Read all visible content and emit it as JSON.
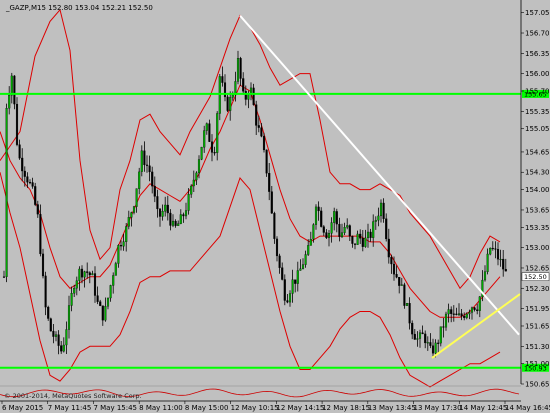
{
  "chart_data": {
    "type": "candlestick",
    "title": "_GAZP,M15  152.80 153.04 152.21 152.50",
    "symbol": "_GAZP,M15",
    "ohlc_header": [
      "152.80",
      "153.04",
      "152.21",
      "152.50"
    ],
    "copyright": "© 2001-2014, MetaQuotes Software Corp.",
    "ylim": [
      150.65,
      157.2
    ],
    "y_ticks": [
      "157.05",
      "156.70",
      "156.35",
      "156.00",
      "155.70",
      "155.35",
      "155.05",
      "154.65",
      "154.30",
      "154.00",
      "153.65",
      "153.35",
      "153.00",
      "152.65",
      "152.30",
      "151.95",
      "151.65",
      "151.30",
      "151.00",
      "150.65"
    ],
    "x_ticks": [
      "6 May 2015",
      "7 May 11:45",
      "7 May 15:45",
      "8 May 11:00",
      "8 May 15:00",
      "12 May 10:15",
      "12 May 14:15",
      "12 May 18:15",
      "13 May 13:45",
      "13 May 17:30",
      "14 May 12:45",
      "14 May 16:45"
    ],
    "horizontal_lines": [
      {
        "price": 155.65,
        "label": "155.65",
        "color": "#00ff00"
      },
      {
        "price": 150.93,
        "label": "150.93",
        "color": "#00ff00"
      }
    ],
    "current_price": {
      "price": 152.5,
      "label": "152.50"
    },
    "trendlines": [
      {
        "color": "#ffffff",
        "from": [
          240,
          157.0
        ],
        "to": [
          519,
          151.5
        ]
      },
      {
        "color": "#ffff55",
        "from": [
          432,
          151.1
        ],
        "to": [
          520,
          152.2
        ]
      }
    ],
    "bollinger_color": "#dd0000",
    "series": {
      "price_path": [
        [
          5,
          155.3
        ],
        [
          12,
          156.0
        ],
        [
          18,
          154.6
        ],
        [
          25,
          154.3
        ],
        [
          32,
          154.0
        ],
        [
          38,
          153.5
        ],
        [
          45,
          152.0
        ],
        [
          50,
          151.6
        ],
        [
          56,
          151.4
        ],
        [
          62,
          151.2
        ],
        [
          68,
          151.8
        ],
        [
          74,
          152.4
        ],
        [
          80,
          152.6
        ],
        [
          86,
          152.6
        ],
        [
          92,
          152.5
        ],
        [
          98,
          152.0
        ],
        [
          104,
          151.8
        ],
        [
          110,
          152.3
        ],
        [
          118,
          153.0
        ],
        [
          126,
          153.3
        ],
        [
          134,
          153.8
        ],
        [
          142,
          154.6
        ],
        [
          150,
          154.3
        ],
        [
          158,
          153.5
        ],
        [
          166,
          153.7
        ],
        [
          174,
          153.3
        ],
        [
          182,
          153.5
        ],
        [
          190,
          153.9
        ],
        [
          198,
          154.5
        ],
        [
          206,
          155.1
        ],
        [
          214,
          154.6
        ],
        [
          220,
          156.0
        ],
        [
          226,
          155.4
        ],
        [
          232,
          155.6
        ],
        [
          238,
          156.2
        ],
        [
          244,
          155.5
        ],
        [
          250,
          155.8
        ],
        [
          256,
          155.2
        ],
        [
          262,
          154.8
        ],
        [
          268,
          154.2
        ],
        [
          274,
          153.2
        ],
        [
          280,
          152.6
        ],
        [
          286,
          152.1
        ],
        [
          292,
          152.4
        ],
        [
          298,
          152.5
        ],
        [
          304,
          152.8
        ],
        [
          310,
          153.0
        ],
        [
          316,
          153.8
        ],
        [
          322,
          153.4
        ],
        [
          328,
          153.2
        ],
        [
          334,
          153.6
        ],
        [
          340,
          153.2
        ],
        [
          346,
          153.4
        ],
        [
          352,
          153.0
        ],
        [
          358,
          153.2
        ],
        [
          364,
          153.1
        ],
        [
          370,
          153.2
        ],
        [
          376,
          153.5
        ],
        [
          382,
          153.8
        ],
        [
          388,
          153.0
        ],
        [
          394,
          152.6
        ],
        [
          400,
          152.4
        ],
        [
          406,
          152.0
        ],
        [
          412,
          151.6
        ],
        [
          418,
          151.4
        ],
        [
          424,
          151.5
        ],
        [
          430,
          151.2
        ],
        [
          436,
          151.3
        ],
        [
          442,
          151.6
        ],
        [
          448,
          151.9
        ],
        [
          454,
          151.8
        ],
        [
          460,
          151.8
        ],
        [
          466,
          151.9
        ],
        [
          472,
          152.0
        ],
        [
          478,
          152.0
        ],
        [
          484,
          152.5
        ],
        [
          490,
          153.0
        ],
        [
          496,
          152.9
        ],
        [
          502,
          152.7
        ],
        [
          507,
          152.5
        ]
      ],
      "bb_upper": [
        [
          0,
          154.5
        ],
        [
          20,
          155.0
        ],
        [
          35,
          156.3
        ],
        [
          50,
          156.9
        ],
        [
          60,
          157.1
        ],
        [
          70,
          156.4
        ],
        [
          80,
          154.5
        ],
        [
          90,
          153.3
        ],
        [
          100,
          152.8
        ],
        [
          110,
          153.0
        ],
        [
          120,
          154.0
        ],
        [
          130,
          154.5
        ],
        [
          140,
          155.2
        ],
        [
          150,
          155.3
        ],
        [
          160,
          155.0
        ],
        [
          170,
          154.8
        ],
        [
          180,
          154.6
        ],
        [
          190,
          155.0
        ],
        [
          200,
          155.3
        ],
        [
          210,
          155.6
        ],
        [
          220,
          156.1
        ],
        [
          230,
          156.6
        ],
        [
          240,
          157.0
        ],
        [
          250,
          156.8
        ],
        [
          260,
          156.5
        ],
        [
          270,
          156.1
        ],
        [
          280,
          155.8
        ],
        [
          290,
          155.9
        ],
        [
          300,
          156.0
        ],
        [
          310,
          156.0
        ],
        [
          320,
          155.2
        ],
        [
          330,
          154.3
        ],
        [
          340,
          154.1
        ],
        [
          350,
          154.1
        ],
        [
          360,
          154.0
        ],
        [
          370,
          154.0
        ],
        [
          380,
          154.1
        ],
        [
          390,
          154.0
        ],
        [
          400,
          153.9
        ],
        [
          410,
          153.6
        ],
        [
          420,
          153.4
        ],
        [
          430,
          153.2
        ],
        [
          440,
          152.9
        ],
        [
          450,
          152.6
        ],
        [
          460,
          152.3
        ],
        [
          470,
          152.5
        ],
        [
          480,
          152.9
        ],
        [
          490,
          153.2
        ],
        [
          500,
          153.1
        ]
      ],
      "bb_middle": [
        [
          0,
          155.0
        ],
        [
          10,
          154.5
        ],
        [
          20,
          154.2
        ],
        [
          30,
          154.0
        ],
        [
          40,
          153.6
        ],
        [
          50,
          153.0
        ],
        [
          60,
          152.5
        ],
        [
          70,
          152.3
        ],
        [
          80,
          152.4
        ],
        [
          90,
          152.5
        ],
        [
          100,
          152.5
        ],
        [
          110,
          152.7
        ],
        [
          120,
          153.1
        ],
        [
          130,
          153.5
        ],
        [
          140,
          153.9
        ],
        [
          150,
          154.1
        ],
        [
          160,
          154.0
        ],
        [
          170,
          153.9
        ],
        [
          180,
          153.8
        ],
        [
          190,
          154.0
        ],
        [
          200,
          154.3
        ],
        [
          210,
          154.7
        ],
        [
          220,
          155.0
        ],
        [
          230,
          155.4
        ],
        [
          240,
          155.8
        ],
        [
          250,
          155.7
        ],
        [
          260,
          155.2
        ],
        [
          270,
          154.6
        ],
        [
          280,
          154.0
        ],
        [
          290,
          153.5
        ],
        [
          300,
          153.2
        ],
        [
          310,
          153.1
        ],
        [
          320,
          153.2
        ],
        [
          330,
          153.2
        ],
        [
          340,
          153.2
        ],
        [
          350,
          153.2
        ],
        [
          360,
          153.2
        ],
        [
          370,
          153.1
        ],
        [
          380,
          153.1
        ],
        [
          390,
          152.9
        ],
        [
          400,
          152.6
        ],
        [
          410,
          152.3
        ],
        [
          420,
          152.1
        ],
        [
          430,
          151.9
        ],
        [
          440,
          151.8
        ],
        [
          450,
          151.8
        ],
        [
          460,
          151.8
        ],
        [
          470,
          151.9
        ],
        [
          480,
          152.1
        ],
        [
          490,
          152.3
        ],
        [
          500,
          152.5
        ]
      ],
      "bb_lower": [
        [
          0,
          154.3
        ],
        [
          10,
          153.6
        ],
        [
          20,
          153.0
        ],
        [
          30,
          152.2
        ],
        [
          40,
          151.4
        ],
        [
          50,
          150.8
        ],
        [
          60,
          150.7
        ],
        [
          70,
          150.9
        ],
        [
          80,
          151.2
        ],
        [
          90,
          151.3
        ],
        [
          100,
          151.3
        ],
        [
          110,
          151.3
        ],
        [
          120,
          151.5
        ],
        [
          130,
          151.9
        ],
        [
          140,
          152.4
        ],
        [
          150,
          152.5
        ],
        [
          160,
          152.5
        ],
        [
          170,
          152.6
        ],
        [
          180,
          152.6
        ],
        [
          190,
          152.6
        ],
        [
          200,
          152.8
        ],
        [
          210,
          153.0
        ],
        [
          220,
          153.2
        ],
        [
          230,
          153.7
        ],
        [
          240,
          154.2
        ],
        [
          250,
          154.0
        ],
        [
          260,
          153.3
        ],
        [
          270,
          152.6
        ],
        [
          280,
          151.9
        ],
        [
          290,
          151.3
        ],
        [
          300,
          150.9
        ],
        [
          310,
          150.9
        ],
        [
          320,
          151.1
        ],
        [
          330,
          151.3
        ],
        [
          340,
          151.6
        ],
        [
          350,
          151.8
        ],
        [
          360,
          151.9
        ],
        [
          370,
          151.9
        ],
        [
          380,
          151.8
        ],
        [
          390,
          151.5
        ],
        [
          400,
          151.1
        ],
        [
          410,
          150.8
        ],
        [
          420,
          150.7
        ],
        [
          430,
          150.6
        ],
        [
          440,
          150.7
        ],
        [
          450,
          150.8
        ],
        [
          460,
          150.9
        ],
        [
          470,
          151.0
        ],
        [
          480,
          151.0
        ],
        [
          490,
          151.1
        ],
        [
          500,
          151.2
        ]
      ]
    }
  },
  "colors": {
    "background": "#c0c0c0",
    "bull_body": "#00aa00",
    "bear_body": "#000000",
    "wick": "#000000",
    "level_line": "#00ff00"
  }
}
